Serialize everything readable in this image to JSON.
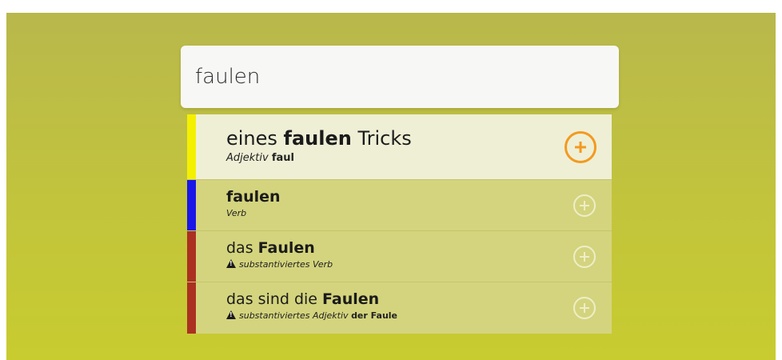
{
  "search": {
    "value": "faulen"
  },
  "results": [
    {
      "pre": "eines ",
      "bold": "faulen",
      "post": " Tricks",
      "pos": "Adjektiv",
      "lemma": "faul",
      "warning": false,
      "color": "#f4f000"
    },
    {
      "pre": "",
      "bold": "faulen",
      "post": "",
      "pos": "Verb",
      "lemma": "",
      "warning": false,
      "color": "#1a16e8"
    },
    {
      "pre": "das ",
      "bold": "Faulen",
      "post": "",
      "pos": "substantiviertes Verb",
      "lemma": "",
      "warning": true,
      "color": "#ab3022"
    },
    {
      "pre": "das sind die ",
      "bold": "Faulen",
      "post": "",
      "pos": "substantiviertes Adjektiv",
      "lemma": "der Faule",
      "warning": true,
      "color": "#ab3022"
    }
  ],
  "icons": {
    "add": "plus-circle-icon",
    "warning": "warning-triangle-icon"
  },
  "colors": {
    "accent": "#f39a1f",
    "background": "#c2c43c",
    "active_row": "#efefd6",
    "row": "#d4d47e"
  }
}
